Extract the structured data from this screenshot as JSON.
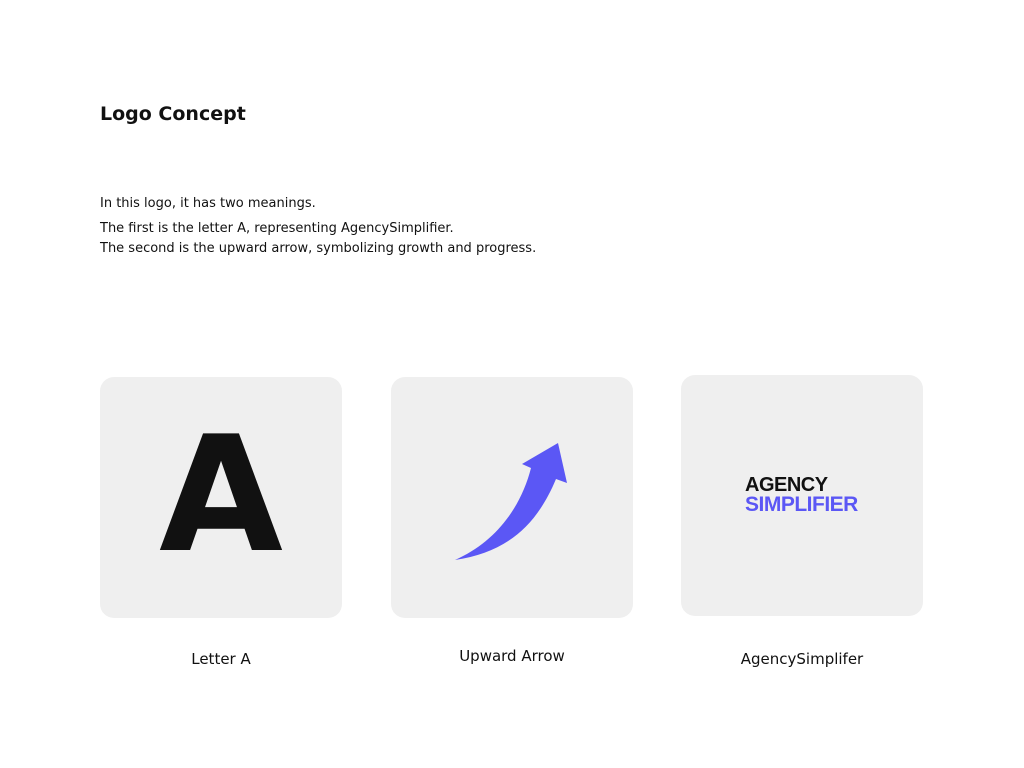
{
  "title": "Logo Concept",
  "description": [
    "In this logo, it has two meanings.",
    "The first is the letter A, representing AgencySimplifier.",
    "The second is the upward arrow, symbolizing growth and progress."
  ],
  "cards": [
    {
      "glyph": "A",
      "caption": "Letter A"
    },
    {
      "icon": "upward-arrow-icon",
      "caption": "Upward Arrow"
    },
    {
      "logo_line1": "AGENCY",
      "logo_line2": "SIMPLIFIER",
      "caption": "AgencySimplifer"
    }
  ],
  "colors": {
    "accent": "#5b57f5",
    "card": "#efefef"
  }
}
